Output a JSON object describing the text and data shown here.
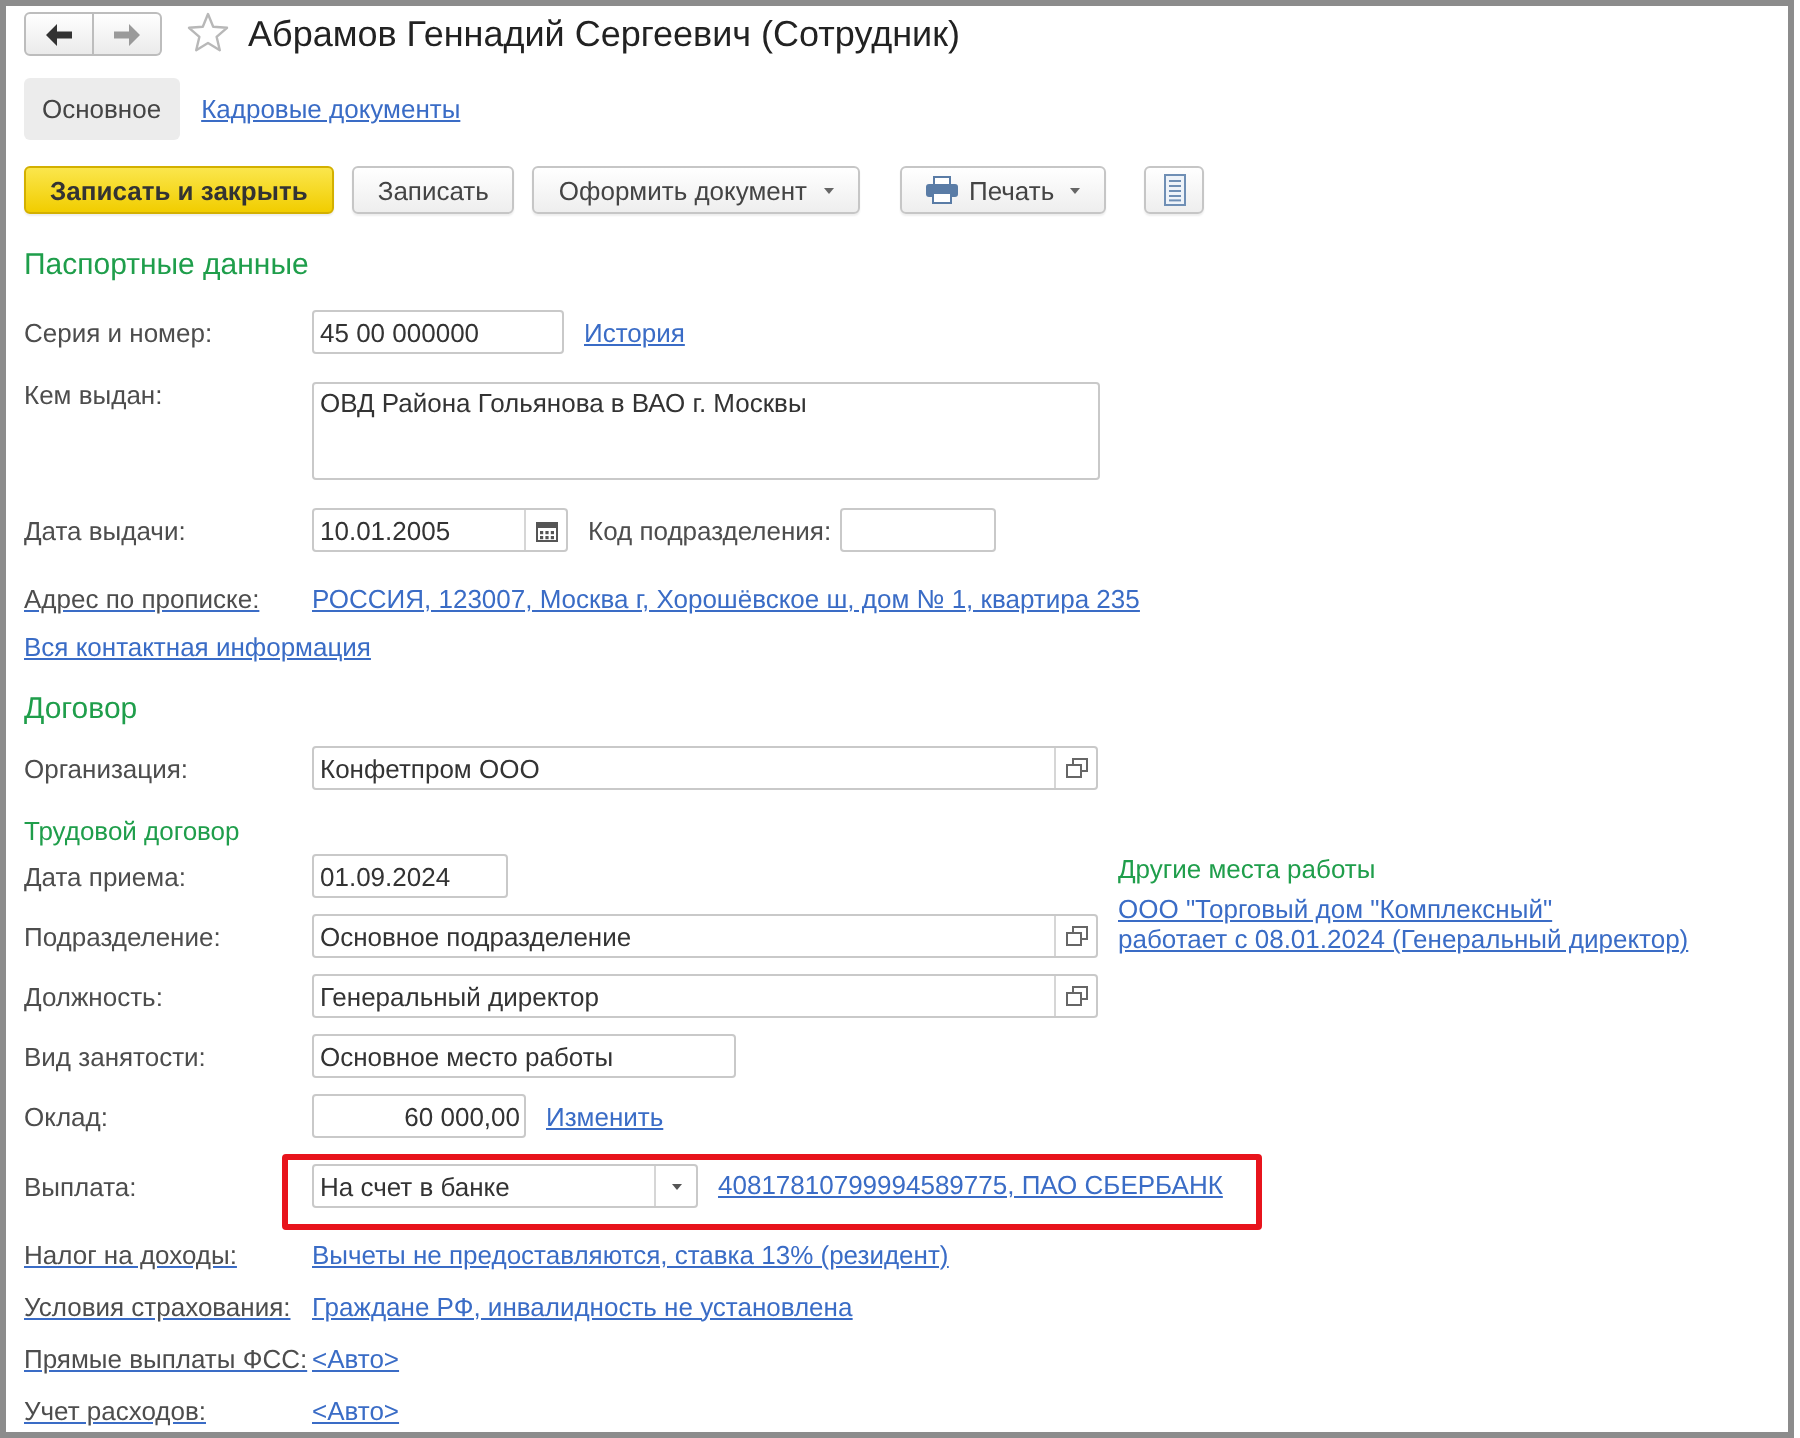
{
  "window": {
    "title": "Абрамов Геннадий Сергеевич (Сотрудник)",
    "favorite": false
  },
  "nav": [
    {
      "kind": "back",
      "disabled": false
    },
    {
      "kind": "forward",
      "disabled": true
    }
  ],
  "tabs": [
    {
      "label": "Основное",
      "selected": true
    },
    {
      "label": "Кадровые документы",
      "selected": false
    }
  ],
  "toolbar": [
    {
      "label": "Записать и закрыть",
      "kind": "primary"
    },
    {
      "label": "Записать",
      "kind": "plain"
    },
    {
      "label": "Оформить документ",
      "kind": "menu"
    },
    {
      "label": "Печать",
      "kind": "print"
    },
    {
      "kind": "list"
    }
  ],
  "passport": {
    "title": "Паспортные данные",
    "rows": [
      {
        "kind": "text",
        "label": "Серия и номер:",
        "value": "45 00 000000",
        "link": "История"
      },
      {
        "kind": "textarea",
        "label": "Кем выдан:",
        "value": "ОВД Района Гольянова в ВАО г. Москвы"
      },
      {
        "kind": "date_picker",
        "label": "Дата выдачи:",
        "value": "10.01.2005",
        "extra_label": "Код подразделения:"
      },
      {
        "kind": "link",
        "label": "Адрес по прописке:",
        "link": "РОССИЯ, 123007, Москва г, Хорошёвское ш, дом № 1, квартира 235"
      }
    ],
    "contact_link": "Вся контактная информация"
  },
  "contract": {
    "title": "Договор",
    "rows_top": [
      {
        "kind": "reference",
        "label": "Организация:",
        "value": "Конфетпром ООО"
      }
    ],
    "subtitle": "Трудовой договор",
    "rows_beside": [
      {
        "kind": "date",
        "label": "Дата приема:",
        "value": "01.09.2024"
      },
      {
        "kind": "reference",
        "label": "Подразделение:",
        "value": "Основное подразделение"
      }
    ],
    "other_jobs": {
      "title": "Другие места работы",
      "lines": [
        "ООО \"Торговый дом \"Комплексный\"",
        "работает с 08.01.2024 (Генеральный директор)"
      ]
    },
    "rows": [
      {
        "kind": "reference",
        "label": "Должность:",
        "value": "Генеральный директор"
      },
      {
        "kind": "choice",
        "label": "Вид занятости:",
        "value": "Основное место работы"
      },
      {
        "kind": "money",
        "label": "Оклад:",
        "value": "60 000,00",
        "link": "Изменить"
      },
      {
        "kind": "select",
        "label": "Выплата:",
        "value": "На счет в банке",
        "link": "40817810799994589775, ПАО СБЕРБАНК",
        "highlighted": true
      },
      {
        "kind": "link",
        "label": "Налог на доходы:",
        "link": "Вычеты не предоставляются, ставка 13% (резидент)"
      },
      {
        "kind": "link",
        "label": "Условия страхования:",
        "link": "Граждане РФ, инвалидность не установлена"
      },
      {
        "kind": "link",
        "label": "Прямые выплаты ФСС:",
        "link": "<Авто>"
      },
      {
        "kind": "link",
        "label": "Учет расходов:",
        "link": "<Авто>"
      }
    ]
  }
}
